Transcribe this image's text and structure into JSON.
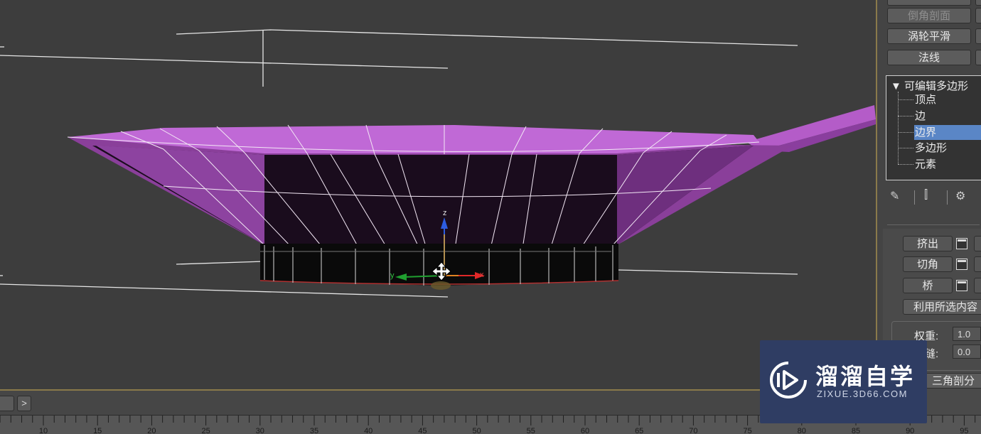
{
  "panel": {
    "top_buttons": [
      "倒角剖面",
      "涡轮平滑",
      "法线"
    ],
    "tree": {
      "root": "可编辑多边形",
      "items": [
        "顶点",
        "边",
        "边界",
        "多边形",
        "元素"
      ],
      "selected_index": 2
    },
    "tool_icons": [
      "pin-icon",
      "pipe-icon",
      "modifier-icon"
    ],
    "ops": [
      "挤出",
      "切角",
      "桥"
    ],
    "use_selection": "利用所选内容",
    "weight_label": "权重:",
    "weight_value": "1.0",
    "crease_label": "折缝:",
    "crease_value": "0.0",
    "triangulate": "三角剖分"
  },
  "viewport": {
    "gizmo_axes": [
      "z",
      "x",
      "y"
    ],
    "colors": {
      "background": "#3d3d3d",
      "bowl": "#b45cc8",
      "highlight_border": "#8a7a4a"
    }
  },
  "timeline": {
    "next_label": ">",
    "ruler_labels": [
      "10",
      "15",
      "20",
      "25",
      "30",
      "35",
      "40",
      "45",
      "50",
      "55",
      "60",
      "65",
      "70",
      "75",
      "80",
      "85",
      "90",
      "95"
    ]
  },
  "watermark": {
    "title": "溜溜自学",
    "subtitle": "ZIXUE.3D66.COM"
  }
}
